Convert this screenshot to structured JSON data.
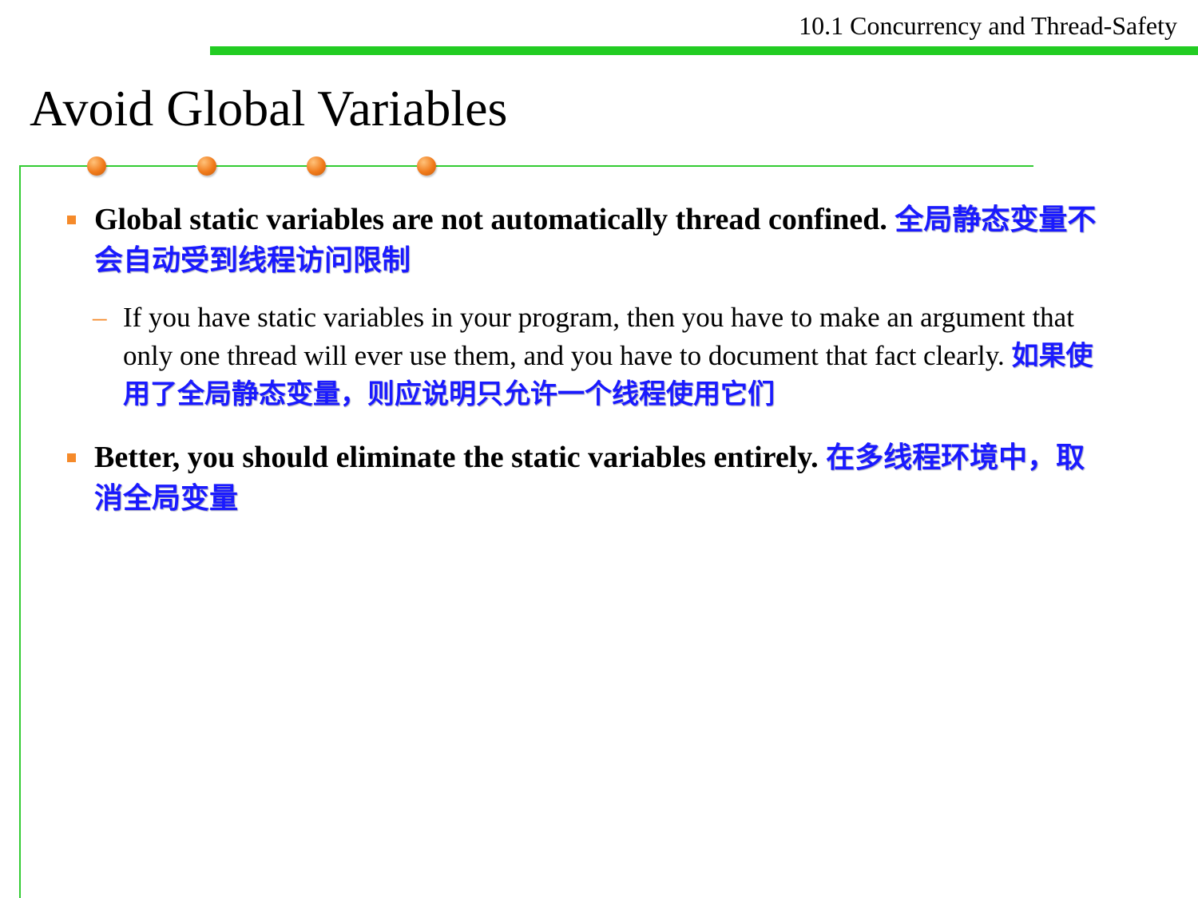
{
  "header": {
    "section_title": "10.1 Concurrency and Thread-Safety"
  },
  "slide": {
    "title": "Avoid Global Variables"
  },
  "bullets": [
    {
      "text": "Global static variables are not automatically thread confined.",
      "translation": "全局静态变量不会自动受到线程访问限制"
    },
    {
      "text": "Better, you should eliminate the static variables entirely.",
      "translation": "在多线程环境中，取消全局变量"
    }
  ],
  "sub_bullets": [
    {
      "marker": "–",
      "text": "If you have static variables in your program, then you have to make an argument that only one thread will ever use them, and you have to document that fact clearly.",
      "translation": "如果使用了全局静态变量，则应说明只允许一个线程使用它们"
    }
  ],
  "colors": {
    "accent_green": "#22cc22",
    "frame_green": "#33cc33",
    "bullet_orange": "#f58a2a",
    "dot_orange": "#f07a1a",
    "translation_blue": "#1a1aff"
  }
}
